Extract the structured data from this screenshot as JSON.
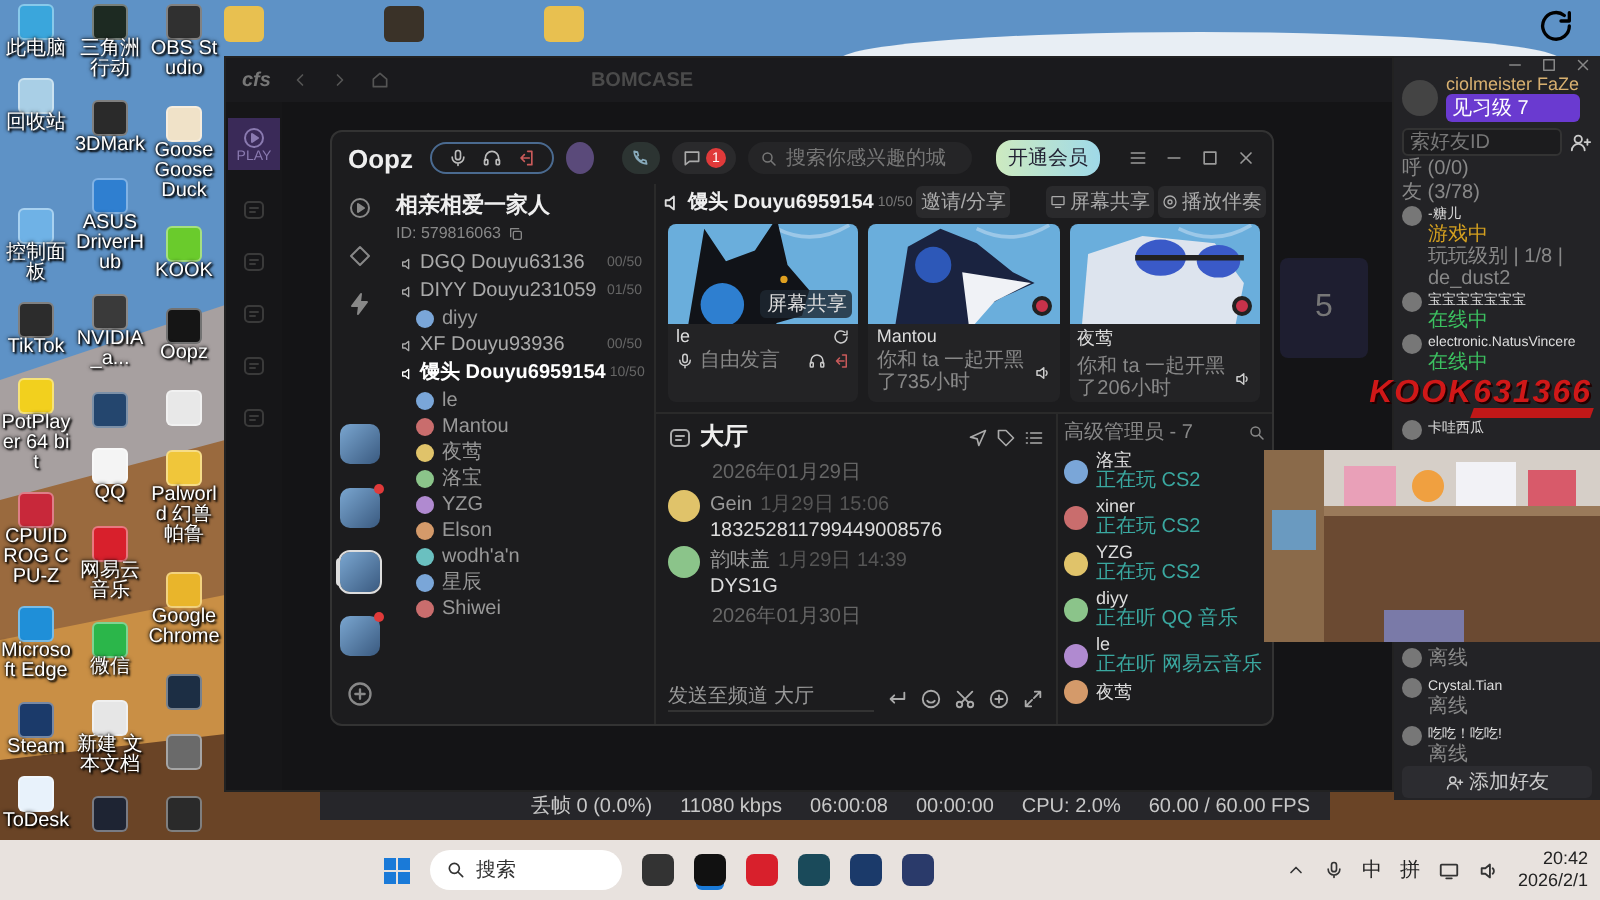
{
  "desktop": {
    "columns": [
      [
        {
          "kind": "app",
          "label": "此电脑",
          "color": "#3aa6dc"
        },
        {
          "kind": "app",
          "label": "回收站",
          "color": "#a9cfe6"
        },
        {
          "kind": "gap"
        },
        {
          "kind": "app",
          "label": "控制面板",
          "color": "#6fb2e6"
        },
        {
          "kind": "app",
          "label": "TikTok",
          "color": "#2c2c2c"
        },
        {
          "kind": "app",
          "label": "PotPlayer 64 bit",
          "color": "#f2d01e"
        },
        {
          "kind": "app",
          "label": "CPUID ROG CPU-Z",
          "color": "#c8283a"
        },
        {
          "kind": "app",
          "label": "Microsoft Edge",
          "color": "#1f8fd8"
        },
        {
          "kind": "app",
          "label": "Steam",
          "color": "#1b3a6a"
        },
        {
          "kind": "app",
          "label": "ToDesk",
          "color": "#e8f2fb"
        }
      ],
      [
        {
          "kind": "app",
          "label": "三角洲行动",
          "color": "#1d2a22"
        },
        {
          "kind": "app",
          "label": "3DMark",
          "color": "#2a2a2a"
        },
        {
          "kind": "app",
          "label": "ASUS DriverHub",
          "color": "#2f7fd0"
        },
        {
          "kind": "app",
          "label": "NVIDIA_a...",
          "color": "#3a3a3a"
        },
        {
          "kind": "app",
          "color": "#24466e"
        },
        {
          "kind": "app",
          "label": "QQ",
          "color": "#f4f4f4"
        },
        {
          "kind": "app",
          "label": "网易云音乐",
          "color": "#d8202c"
        },
        {
          "kind": "app",
          "label": "微信",
          "color": "#2bb64a"
        },
        {
          "kind": "app",
          "label": "新建 文本文档",
          "color": "#e6e6e6"
        },
        {
          "kind": "app",
          "color": "#1e2433"
        }
      ],
      [
        {
          "kind": "app",
          "label": "OBS Studio",
          "color": "#303030"
        },
        {
          "kind": "app",
          "label": "Goose Goose Duck",
          "color": "#f0e2c8"
        },
        {
          "kind": "app",
          "label": "KOOK",
          "color": "#6acb2c"
        },
        {
          "kind": "app",
          "label": "Oopz",
          "color": "#151515"
        },
        {
          "kind": "app",
          "color": "#e8e8e8"
        },
        {
          "kind": "app",
          "label": "Palworld 幻兽帕鲁",
          "color": "#f0c63a"
        },
        {
          "kind": "app",
          "label": "Google Chrome",
          "color": "#e9b52b"
        },
        {
          "kind": "app",
          "color": "#1c2e44"
        },
        {
          "kind": "app",
          "color": "#6a6a6a"
        },
        {
          "kind": "app",
          "color": "#2a2a2a"
        }
      ]
    ]
  },
  "launcher": {
    "title": "cfs",
    "brand": "BOMCASE",
    "tile": "PLAY",
    "counter": "5"
  },
  "obs_status": [
    "丢帧 0 (0.0%)",
    "11080 kbps",
    "06:00:08",
    "00:00:00",
    "CPU: 2.0%",
    "60.00 / 60.00 FPS"
  ],
  "oopz": {
    "logo": "Oopz",
    "notification_count": "1",
    "search": {
      "placeholder": "搜索你感兴趣的城"
    },
    "vip_button": "开通会员",
    "server": {
      "name": "相亲相爱一家人",
      "id": "ID: 579816063"
    },
    "servers": [
      {
        "selected": false,
        "unread": false
      },
      {
        "selected": false,
        "unread": true
      },
      {
        "selected": true,
        "unread": false
      },
      {
        "selected": false,
        "unread": true
      }
    ],
    "channels": [
      {
        "name": "DGQ Douyu63136",
        "count": "00/50",
        "selected": false
      },
      {
        "name": "DIYY Douyu231059",
        "count": "01/50",
        "selected": false,
        "children": [
          {
            "name": "diyy"
          }
        ]
      },
      {
        "name": "XF Douyu93936",
        "count": "00/50",
        "selected": false
      },
      {
        "name": "馒头 Douyu6959154",
        "count": "10/50",
        "selected": true,
        "children": [
          {
            "name": "le"
          },
          {
            "name": "Mantou"
          },
          {
            "name": "夜莺"
          },
          {
            "name": "洛宝"
          },
          {
            "name": "YZG"
          },
          {
            "name": "Elson"
          },
          {
            "name": "wodh'a'n"
          },
          {
            "name": "星辰"
          },
          {
            "name": "Shiwei"
          }
        ]
      }
    ],
    "room": {
      "name": "馒头 Douyu6959154",
      "count": "10/50",
      "invite": "邀请/分享",
      "actions": [
        "屏幕共享",
        "播放伴奏"
      ]
    },
    "cards": [
      {
        "kind": "self",
        "name": "le",
        "share": "屏幕共享",
        "mic": "自由发言"
      },
      {
        "kind": "member",
        "name": "Mantou",
        "note": "你和 ta 一起开黑了735小时"
      },
      {
        "kind": "member",
        "name": "夜莺",
        "note": "你和 ta 一起开黑了206小时"
      }
    ],
    "chat": {
      "title": "大厅",
      "items": [
        {
          "kind": "date",
          "text": "2026年01月29日"
        },
        {
          "kind": "message",
          "author": "Gein",
          "time": "1月29日 15:06",
          "text": "183252811799449008576"
        },
        {
          "kind": "message",
          "author": "韵味盖",
          "time": "1月29日 14:39",
          "text": "DYS1G"
        },
        {
          "kind": "date",
          "text": "2026年01月30日"
        }
      ],
      "placeholder": "发送至频道 大厅"
    },
    "members": {
      "title": "高级管理员 - 7",
      "items": [
        {
          "name": "洛宝",
          "activity": "正在玩 CS2"
        },
        {
          "name": "xiner",
          "activity": "正在玩 CS2"
        },
        {
          "name": "YZG",
          "activity": "正在玩 CS2"
        },
        {
          "name": "diyy",
          "activity": "正在听 QQ 音乐"
        },
        {
          "name": "le",
          "activity": "正在听 网易云音乐"
        },
        {
          "name": "夜莺"
        }
      ]
    }
  },
  "friends_panel": {
    "profile": {
      "name": "ciolmeister FaZe",
      "badge": "见习级 7"
    },
    "search": {
      "placeholder": "索好友ID"
    },
    "sections": [
      "呼 (0/0)",
      "友 (3/78)"
    ],
    "friends_above": [
      {
        "name": "-糖儿",
        "status": "游戏中",
        "kind": "game",
        "detail": "玩玩级别 | 1/8 | de_dust2"
      },
      {
        "name": "宝宝宝宝宝宝宝",
        "status": "在线中",
        "kind": "online"
      },
      {
        "name": "electronic.NatusVincere",
        "status": "在线中",
        "kind": "online"
      }
    ],
    "friends_after_overlay": [
      {
        "name": "卡哇西瓜"
      }
    ],
    "friends_below": [
      {
        "status": "离线",
        "kind": "offline"
      },
      {
        "name": "Crystal.Tian",
        "status": "离线",
        "kind": "offline"
      },
      {
        "name": "吃吃！吃吃!",
        "status": "离线",
        "kind": "offline"
      }
    ],
    "add_button": "添加好友"
  },
  "stream_overlay": {
    "text": "KOOK631366"
  },
  "taskbar": {
    "search": "搜索",
    "ime": [
      "中",
      "拼"
    ],
    "time": "20:42",
    "date": "2026/2/1"
  }
}
